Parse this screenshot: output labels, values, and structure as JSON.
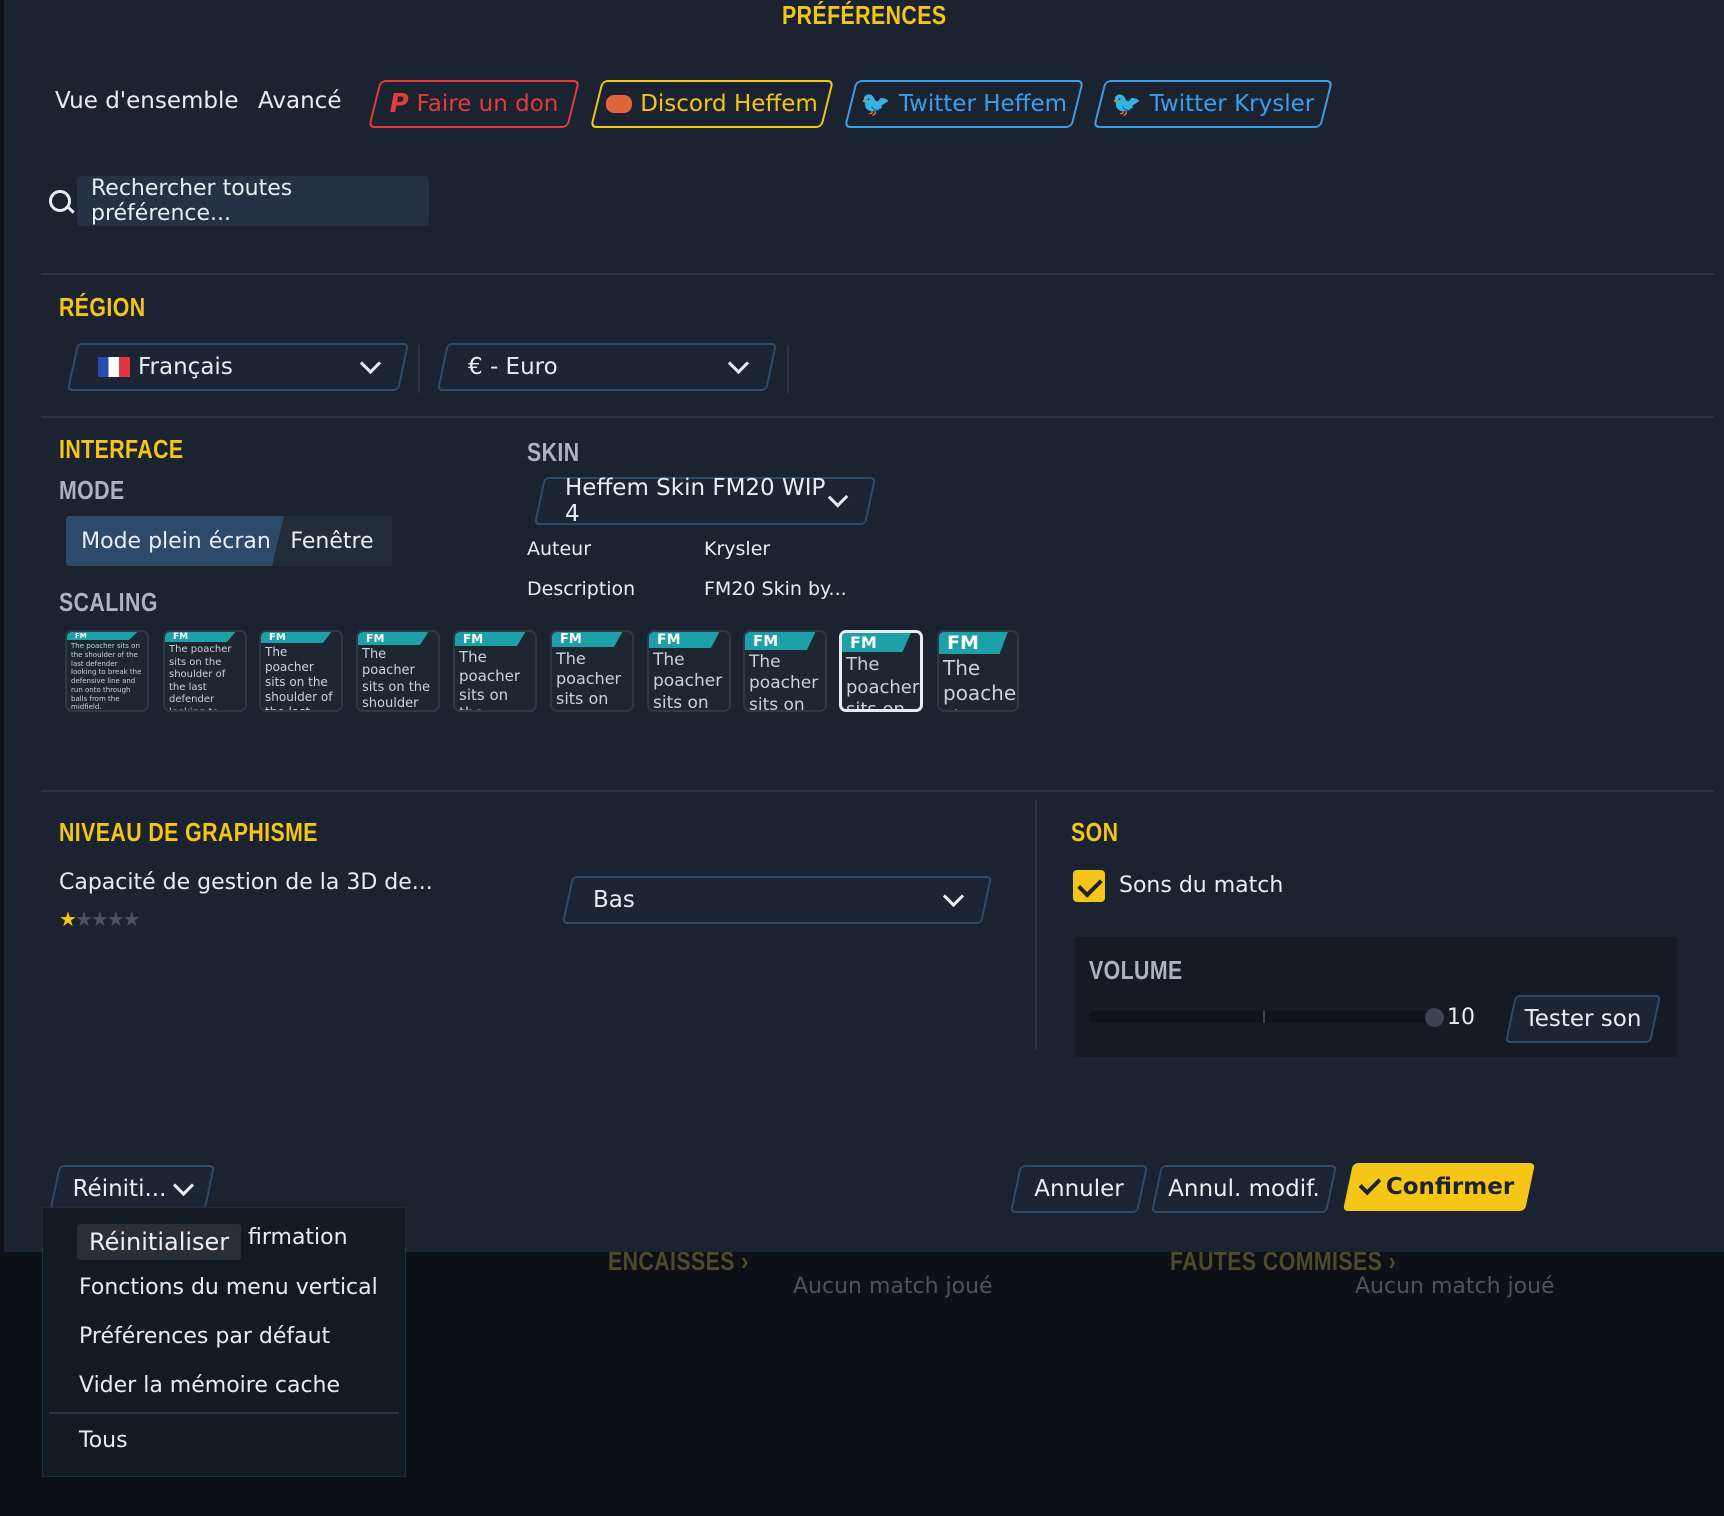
{
  "header": {
    "title": "PRÉFÉRENCES"
  },
  "tabs": {
    "overview": "Vue d'ensemble",
    "advanced": "Avancé"
  },
  "links": [
    {
      "label": "Faire un don",
      "color": "#e23b3b",
      "icon": "paypal-icon"
    },
    {
      "label": "Discord Heffem",
      "color": "#f5c518",
      "icon": "discord-icon"
    },
    {
      "label": "Twitter Heffem",
      "color": "#3a9fe8",
      "icon": "twitter-icon"
    },
    {
      "label": "Twitter Krysler",
      "color": "#3a9fe8",
      "icon": "twitter-icon"
    }
  ],
  "search": {
    "value": "Rechercher toutes préférence..."
  },
  "region": {
    "title": "RÉGION",
    "language": "Français",
    "currency": "€ - Euro"
  },
  "interface": {
    "title": "INTERFACE",
    "mode_title": "MODE",
    "mode_full": "Mode plein écran",
    "mode_window": "Fenêtre",
    "scaling_title": "SCALING",
    "thumb_label": "FM",
    "thumb_text": "The poacher sits on the shoulder of the last defender looking to break the defensive line and run onto through balls from the midfield.",
    "selected_scale_index": 8
  },
  "skin": {
    "title": "SKIN",
    "selected": "Heffem Skin FM20 WIP 4",
    "author_label": "Auteur",
    "author": "Krysler",
    "description_label": "Description",
    "description": "FM20 Skin by..."
  },
  "graphics": {
    "title": "NIVEAU DE GRAPHISME",
    "capability": "Capacité de gestion de la 3D de...",
    "stars": 1,
    "stars_max": 5,
    "level": "Bas"
  },
  "sound": {
    "title": "SON",
    "match_sounds": "Sons du match",
    "match_sounds_checked": true,
    "volume_title": "VOLUME",
    "volume_value": "10",
    "volume_fraction": 1.0,
    "test_button": "Tester son"
  },
  "footer": {
    "reset_button": "Réiniti...",
    "cancel": "Annuler",
    "undo": "Annul. modif.",
    "confirm": "Confirmer"
  },
  "reset_menu": {
    "tooltip": "Réinitialiser",
    "items": [
      "firmation",
      "Fonctions du menu vertical",
      "Préférences par défaut",
      "Vider la mémoire cache"
    ],
    "all": "Tous"
  },
  "background": {
    "conceded": "ENCAISSÉS ›",
    "fouls": "FAUTES COMMISES ›",
    "no_match_1": "Aucun match joué",
    "no_match_2": "Aucun match joué"
  },
  "colors": {
    "accent": "#f5c518",
    "panel": "#1b2330",
    "selected": "#2e4a6b"
  }
}
